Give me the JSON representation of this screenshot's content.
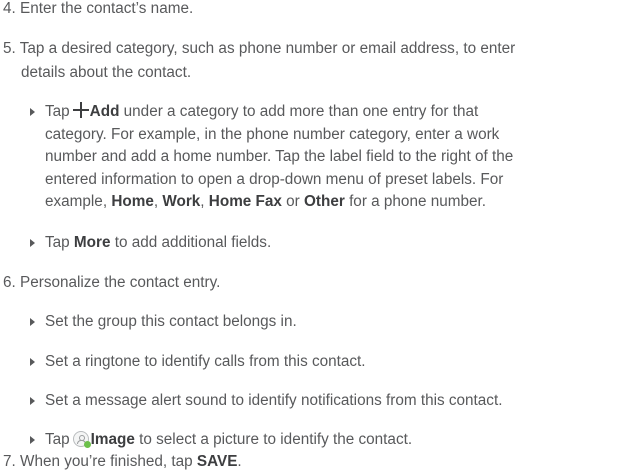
{
  "steps": {
    "s4": {
      "num": "4.",
      "text": "Enter the contact’s name."
    },
    "s5": {
      "num": "5.",
      "line1": "Tap a desired category, such as phone number or email address, to enter",
      "line2": "details about the contact."
    },
    "b1": {
      "pre": "Tap",
      "add": "Add",
      "line1_post": "under a category to add more than one entry for that",
      "line2": "category. For example, in the phone number category, enter a work",
      "line3": "number and add a home number. Tap the label field to the right of the",
      "line4": "entered information to open a drop-down menu of preset labels. For",
      "line5_pre": "example,",
      "home": "Home",
      "comma1": ",",
      "work": "Work",
      "comma2": ",",
      "homefax": "Home Fax",
      "or": "or",
      "other": "Other",
      "line5_post": "for a phone number."
    },
    "b2": {
      "pre": "Tap",
      "more": "More",
      "post": "to add additional fields."
    },
    "s6": {
      "num": "6.",
      "text": "Personalize the contact entry."
    },
    "b3": {
      "text": "Set the group this contact belongs in."
    },
    "b4": {
      "text": "Set a ringtone to identify calls from this contact."
    },
    "b5": {
      "text": "Set a message alert sound to identify notifications from this contact."
    },
    "b6": {
      "pre": "Tap",
      "image": "Image",
      "post": "to select a picture to identify the contact."
    },
    "s7": {
      "num": "7.",
      "pre": "When you’re finished, tap",
      "save": "SAVE",
      "post": "."
    }
  },
  "icons": {
    "plus": "plus-icon",
    "image": "image-add-icon",
    "bullet": "triangle-bullet-icon"
  },
  "colors": {
    "text": "#58595b",
    "bold": "#3d3e40",
    "image_badge": "#6cc04a"
  }
}
